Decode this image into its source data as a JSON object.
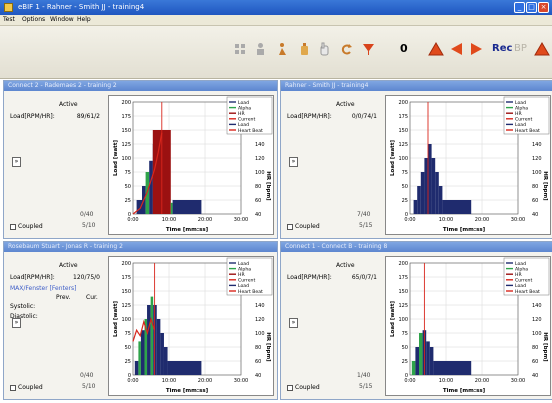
{
  "window": {
    "title": "eBIF 1 - Rahner - Smith JJ - training4"
  },
  "menu": [
    "Test",
    "Options",
    "Window",
    "Help"
  ],
  "toolbar": {
    "counter": "0",
    "rec_label": "Rec",
    "bp_label": "BP"
  },
  "legend_items": [
    "Load",
    "Alpha",
    "HR",
    "Current",
    "Load",
    "Heart Beat"
  ],
  "panels": [
    {
      "title": "Connect 2 - Rademaes 2 - training 2",
      "active_label": "Active",
      "reading_label": "Load[RPM/HR]:",
      "reading_value": "89/61/2",
      "count": "0/40",
      "count2": "5/10",
      "coupled_label": "Coupled",
      "chart_data": {
        "type": "bar",
        "series": [
          {
            "name": "Load",
            "color": "#1f2b6e"
          },
          {
            "name": "Alpha",
            "color": "#2ea34a"
          },
          {
            "name": "HR",
            "color": "#9b1111"
          },
          {
            "name": "Current",
            "color": "#d9261c"
          },
          {
            "name": "Load",
            "color": "#1f2b6e"
          },
          {
            "name": "Heart Beat",
            "color": "#d9261c"
          }
        ],
        "y_ticks_left": [
          "0",
          "25",
          "50",
          "75",
          "100",
          "125",
          "150",
          "175",
          "200"
        ],
        "y_ticks_right": [
          "40",
          "60",
          "80",
          "100",
          "120",
          "140",
          "160",
          "180",
          "200"
        ],
        "x_ticks": [
          "0:00",
          "10:00",
          "20:00",
          "30:00"
        ],
        "ylabel": "Load [watt]",
        "ylabel_right": "HR [bpm]",
        "xlabel": "Time [mm:ss]",
        "ylim": [
          0,
          200
        ],
        "xlim": [
          0,
          30
        ],
        "bars": [
          {
            "x0": 1,
            "x1": 2.5,
            "y": 25,
            "color": "#1f2b6e"
          },
          {
            "x0": 2.5,
            "x1": 3.5,
            "y": 50,
            "color": "#1f2b6e"
          },
          {
            "x0": 3.5,
            "x1": 4.5,
            "y": 75,
            "color": "#2ea34a"
          },
          {
            "x0": 4.5,
            "x1": 5.5,
            "y": 95,
            "color": "#1f2b6e"
          },
          {
            "x0": 5.5,
            "x1": 8,
            "y": 125,
            "color": "#1f2b6e"
          },
          {
            "x0": 5.8,
            "x1": 7.8,
            "y": 150,
            "color": "#1f2b6e"
          },
          {
            "x0": 5.5,
            "x1": 10.5,
            "y": 150,
            "color": "#9b1111"
          },
          {
            "x0": 10.5,
            "x1": 11,
            "y": 20,
            "color": "#2ea34a"
          },
          {
            "x0": 11,
            "x1": 19,
            "y": 25,
            "color": "#1f2b6e"
          }
        ],
        "vline": 8,
        "hr_line": [
          [
            0,
            0
          ],
          [
            2,
            10
          ],
          [
            3,
            25
          ],
          [
            4,
            40
          ],
          [
            5,
            60
          ],
          [
            6,
            80
          ],
          [
            7,
            110
          ],
          [
            8,
            145
          ]
        ]
      }
    },
    {
      "title": "Rahner - Smith JJ - training4",
      "active_label": "Active",
      "reading_label": "Load[RPM/HR]:",
      "reading_value": "0/0/74/1",
      "count": "7/40",
      "count2": "5/15",
      "coupled_label": "Coupled",
      "chart_data": {
        "type": "bar",
        "series": [
          {
            "name": "Load",
            "color": "#1f2b6e"
          },
          {
            "name": "Alpha",
            "color": "#2ea34a"
          },
          {
            "name": "HR",
            "color": "#9b1111"
          },
          {
            "name": "Current",
            "color": "#d9261c"
          },
          {
            "name": "Load",
            "color": "#1f2b6e"
          },
          {
            "name": "Heart Beat",
            "color": "#d9261c"
          }
        ],
        "y_ticks_left": [
          "0",
          "25",
          "50",
          "75",
          "100",
          "125",
          "150",
          "175",
          "200"
        ],
        "y_ticks_right": [
          "40",
          "60",
          "80",
          "100",
          "120",
          "140",
          "160",
          "180",
          "200"
        ],
        "x_ticks": [
          "0:00",
          "10:00",
          "20:00",
          "30:00"
        ],
        "ylabel": "Load [watt]",
        "ylabel_right": "HR [bpm]",
        "xlabel": "Time [mm:ss]",
        "ylim": [
          0,
          200
        ],
        "xlim": [
          0,
          30
        ],
        "bars": [
          {
            "x0": 1,
            "x1": 2,
            "y": 25,
            "color": "#1f2b6e"
          },
          {
            "x0": 2,
            "x1": 3,
            "y": 50,
            "color": "#1f2b6e"
          },
          {
            "x0": 3,
            "x1": 4,
            "y": 75,
            "color": "#1f2b6e"
          },
          {
            "x0": 4,
            "x1": 5,
            "y": 100,
            "color": "#1f2b6e"
          },
          {
            "x0": 5,
            "x1": 6,
            "y": 125,
            "color": "#1f2b6e"
          },
          {
            "x0": 6,
            "x1": 7,
            "y": 100,
            "color": "#1f2b6e"
          },
          {
            "x0": 7,
            "x1": 8,
            "y": 75,
            "color": "#1f2b6e"
          },
          {
            "x0": 8,
            "x1": 9,
            "y": 50,
            "color": "#1f2b6e"
          },
          {
            "x0": 9,
            "x1": 17,
            "y": 25,
            "color": "#1f2b6e"
          }
        ],
        "vline": 5,
        "hr_line": []
      }
    },
    {
      "title": "Rosebaum Stuart - Jonas R - training 2",
      "active_label": "Active",
      "reading_label": "Load[RPM/HR]:",
      "reading_value": "120/75/0",
      "blue_label": "MAX/Fenster [Fenters]",
      "sub_label_a": "Prev.",
      "sub_label_b": "Cur.",
      "systolic_label": "Systolic:",
      "diastolic_label": "Diastolic:",
      "count": "0/40",
      "count2": "5/10",
      "coupled_label": "Coupled",
      "chart_data": {
        "type": "bar",
        "series": [
          {
            "name": "Load",
            "color": "#1f2b6e"
          },
          {
            "name": "Alpha",
            "color": "#2ea34a"
          },
          {
            "name": "HR",
            "color": "#9b1111"
          },
          {
            "name": "Current",
            "color": "#d9261c"
          },
          {
            "name": "Load",
            "color": "#1f2b6e"
          },
          {
            "name": "Heart Beat",
            "color": "#d9261c"
          }
        ],
        "y_ticks_left": [
          "0",
          "25",
          "50",
          "75",
          "100",
          "125",
          "150",
          "175",
          "200"
        ],
        "y_ticks_right": [
          "40",
          "60",
          "80",
          "100",
          "120",
          "140",
          "160",
          "180",
          "200"
        ],
        "x_ticks": [
          "0:00",
          "10:00",
          "20:00",
          "30:00"
        ],
        "ylabel": "Load [watt]",
        "ylabel_right": "HR [bpm]",
        "xlabel": "Time [mm:ss]",
        "ylim": [
          0,
          200
        ],
        "xlim": [
          0,
          30
        ],
        "bars": [
          {
            "x0": 0.5,
            "x1": 1.5,
            "y": 25,
            "color": "#1f2b6e"
          },
          {
            "x0": 1.5,
            "x1": 2.2,
            "y": 60,
            "color": "#2ea34a"
          },
          {
            "x0": 2.2,
            "x1": 3.2,
            "y": 80,
            "color": "#1f2b6e"
          },
          {
            "x0": 3.2,
            "x1": 3.9,
            "y": 100,
            "color": "#2ea34a"
          },
          {
            "x0": 3.9,
            "x1": 4.9,
            "y": 125,
            "color": "#1f2b6e"
          },
          {
            "x0": 4.9,
            "x1": 5.6,
            "y": 140,
            "color": "#2ea34a"
          },
          {
            "x0": 5.6,
            "x1": 6.6,
            "y": 125,
            "color": "#1f2b6e"
          },
          {
            "x0": 6.6,
            "x1": 7.6,
            "y": 100,
            "color": "#1f2b6e"
          },
          {
            "x0": 7.6,
            "x1": 8.6,
            "y": 75,
            "color": "#1f2b6e"
          },
          {
            "x0": 8.6,
            "x1": 9.6,
            "y": 50,
            "color": "#1f2b6e"
          },
          {
            "x0": 9.6,
            "x1": 19,
            "y": 25,
            "color": "#1f2b6e"
          }
        ],
        "vline": 6,
        "hr_line": [
          [
            0,
            60
          ],
          [
            1,
            80
          ],
          [
            2,
            70
          ],
          [
            3,
            95
          ],
          [
            4,
            75
          ],
          [
            5,
            100
          ],
          [
            6,
            80
          ]
        ]
      }
    },
    {
      "title": "Connect 1 - Connect B - training 8",
      "active_label": "Active",
      "reading_label": "Load[RPM/HR]:",
      "reading_value": "65/0/7/1",
      "count": "1/40",
      "count2": "5/15",
      "coupled_label": "Coupled",
      "chart_data": {
        "type": "bar",
        "series": [
          {
            "name": "Load",
            "color": "#1f2b6e"
          },
          {
            "name": "Alpha",
            "color": "#2ea34a"
          },
          {
            "name": "HR",
            "color": "#9b1111"
          },
          {
            "name": "Current",
            "color": "#d9261c"
          },
          {
            "name": "Load",
            "color": "#1f2b6e"
          },
          {
            "name": "Heart Beat",
            "color": "#d9261c"
          }
        ],
        "y_ticks_left": [
          "0",
          "25",
          "50",
          "75",
          "100",
          "125",
          "150",
          "175",
          "200"
        ],
        "y_ticks_right": [
          "40",
          "60",
          "80",
          "100",
          "120",
          "140",
          "160",
          "180",
          "200"
        ],
        "x_ticks": [
          "0:00",
          "10:00",
          "20:00",
          "30:00"
        ],
        "ylabel": "Load [watt]",
        "ylabel_right": "HR [bpm]",
        "xlabel": "Time [mm:ss]",
        "ylim": [
          0,
          200
        ],
        "xlim": [
          0,
          30
        ],
        "bars": [
          {
            "x0": 0.5,
            "x1": 1.5,
            "y": 25,
            "color": "#2ea34a"
          },
          {
            "x0": 1.5,
            "x1": 2.5,
            "y": 50,
            "color": "#1f2b6e"
          },
          {
            "x0": 2.5,
            "x1": 3.5,
            "y": 75,
            "color": "#2ea34a"
          },
          {
            "x0": 3.5,
            "x1": 4.5,
            "y": 80,
            "color": "#1f2b6e"
          },
          {
            "x0": 4.5,
            "x1": 5.5,
            "y": 60,
            "color": "#1f2b6e"
          },
          {
            "x0": 5.5,
            "x1": 6.5,
            "y": 50,
            "color": "#1f2b6e"
          },
          {
            "x0": 6.5,
            "x1": 17,
            "y": 25,
            "color": "#1f2b6e"
          }
        ],
        "vline": 4,
        "hr_line": []
      }
    }
  ]
}
